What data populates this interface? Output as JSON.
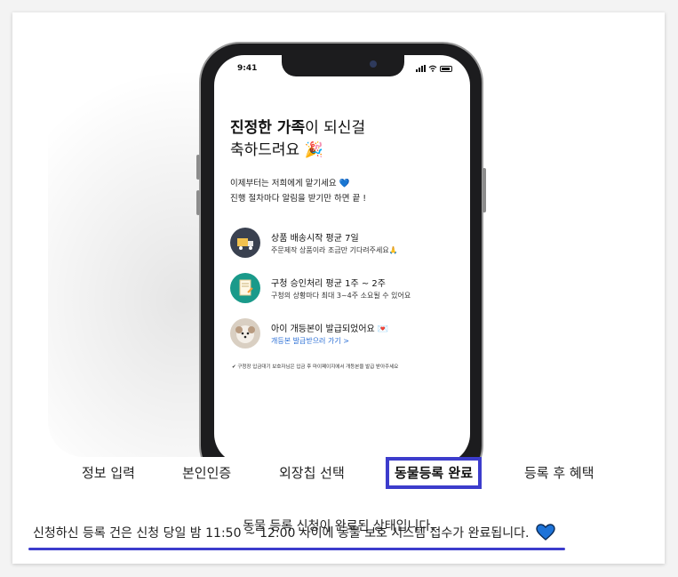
{
  "phone": {
    "status_time": "9:41",
    "title_bold": "진정한 가족",
    "title_rest": "이 되신걸",
    "title_line2": "축하드려요",
    "celebrate_emoji": "🎉",
    "sub_line1": "이제부터는 저희에게 맡기세요",
    "sub_heart": "💙",
    "sub_line2": "진행 절차마다 알림을 받기만 하면 끝 !",
    "steps": [
      {
        "icon": "delivery-truck-icon",
        "title": "상품 배송시작 평균 7일",
        "desc": "주문제작 상품이라 조금만 기다려주세요🙏"
      },
      {
        "icon": "document-pencil-icon",
        "title": "구청 승인처리 평균 1주 ~ 2주",
        "desc": "구청의 상황마다 최대 3~4주 소요될 수 있어요"
      },
      {
        "icon": "puppy-photo-icon",
        "title": "아이 개등본이 발급되었어요 💌",
        "link": "개등본 발급받으러 가기 >"
      }
    ],
    "footnote": "✔ 구청장 입금대기 보호자님은 입금 후 마이페이지에서 개등본을 발급 받아주세요"
  },
  "tabs": [
    {
      "label": "정보 입력",
      "active": false
    },
    {
      "label": "본인인증",
      "active": false
    },
    {
      "label": "외장칩 선택",
      "active": false
    },
    {
      "label": "동물등록 완료",
      "active": true
    },
    {
      "label": "등록 후 혜택",
      "active": false
    }
  ],
  "message": {
    "line1": "동물 등록 신청이 완료된 상태입니다.",
    "line2": "신청하신 등록 건은 신청 당일 밤 11:50 ~ 12:00 사이에 동물 보호 시스템 접수가 완료됩니다."
  },
  "colors": {
    "accent": "#3c3ccc",
    "heart": "#1e73d8",
    "link": "#2b6fd6",
    "teal": "#1a9a8a"
  }
}
